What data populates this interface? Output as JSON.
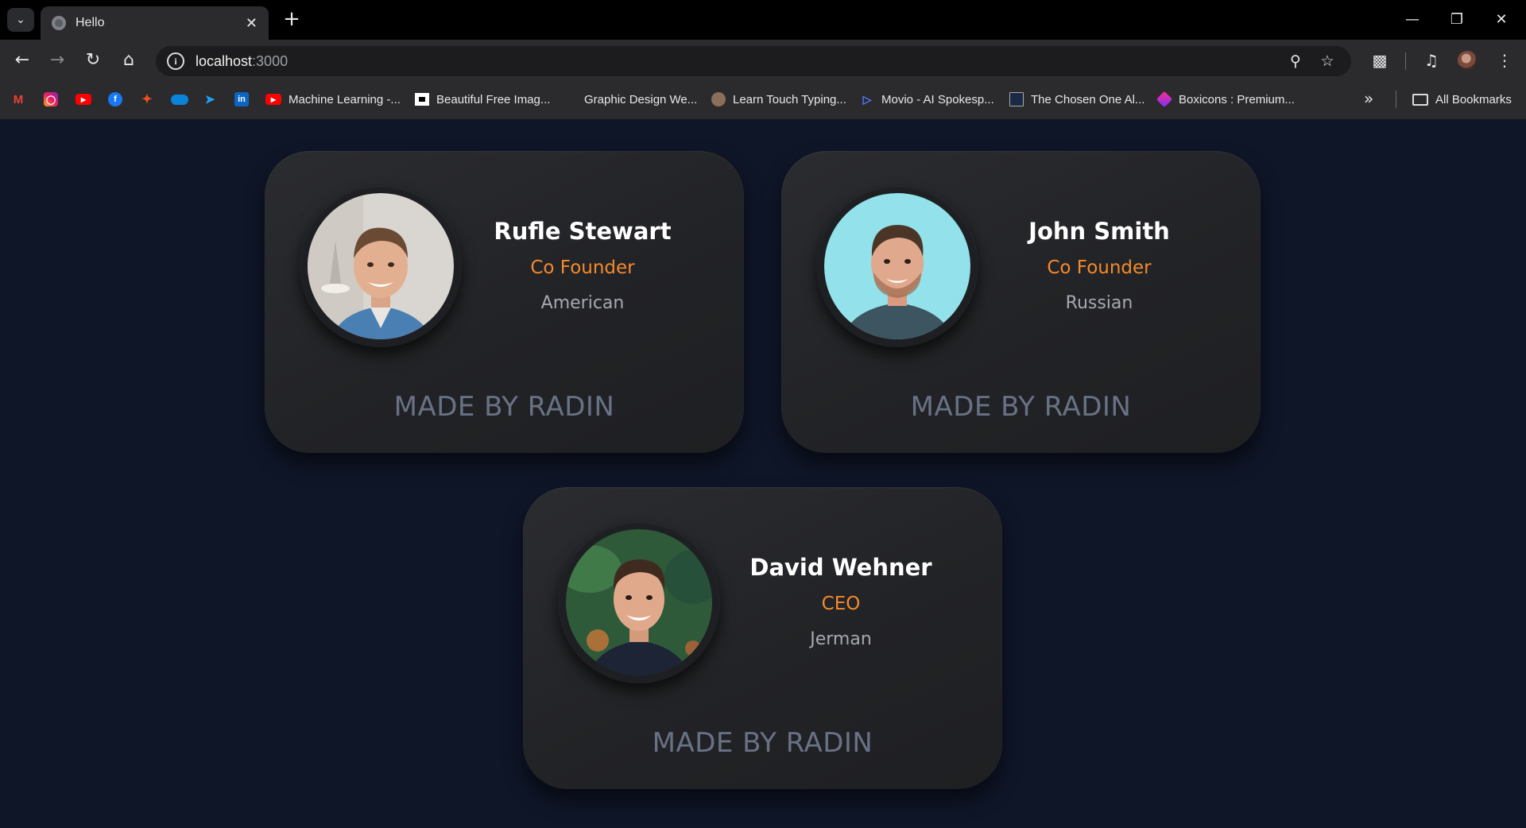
{
  "browser": {
    "tab_title": "Hello",
    "url_host": "localhost",
    "url_port": ":3000",
    "bookmarks": [
      {
        "icon": "gmail-icon",
        "label": ""
      },
      {
        "icon": "instagram-icon",
        "label": ""
      },
      {
        "icon": "youtube-icon",
        "label": ""
      },
      {
        "icon": "facebook-icon",
        "label": ""
      },
      {
        "icon": "figma-icon",
        "label": ""
      },
      {
        "icon": "onedrive-icon",
        "label": ""
      },
      {
        "icon": "bird-icon",
        "label": ""
      },
      {
        "icon": "linkedin-icon",
        "label": ""
      },
      {
        "icon": "youtube-icon",
        "label": "Machine Learning -..."
      },
      {
        "icon": "unsplash-icon",
        "label": "Beautiful Free Imag..."
      },
      {
        "icon": "blank-icon",
        "label": "Graphic Design We..."
      },
      {
        "icon": "typing-icon",
        "label": "Learn Touch Typing..."
      },
      {
        "icon": "movio-icon",
        "label": "Movio - AI Spokesp..."
      },
      {
        "icon": "chosen-icon",
        "label": "The Chosen One Al..."
      },
      {
        "icon": "boxicons-icon",
        "label": "Boxicons : Premium..."
      }
    ],
    "all_bookmarks": "All Bookmarks"
  },
  "cards": [
    {
      "name": "Rufle Stewart",
      "role": "Co Founder",
      "country": "American",
      "footer": "MADE BY RADIN"
    },
    {
      "name": "John Smith",
      "role": "Co Founder",
      "country": "Russian",
      "footer": "MADE BY RADIN"
    },
    {
      "name": "David Wehner",
      "role": "CEO",
      "country": "Jerman",
      "footer": "MADE BY RADIN"
    }
  ],
  "colors": {
    "page_background": "#0f1628",
    "card_background": "#242528",
    "role_accent": "#f58a2c",
    "footer_text": "#697285"
  }
}
